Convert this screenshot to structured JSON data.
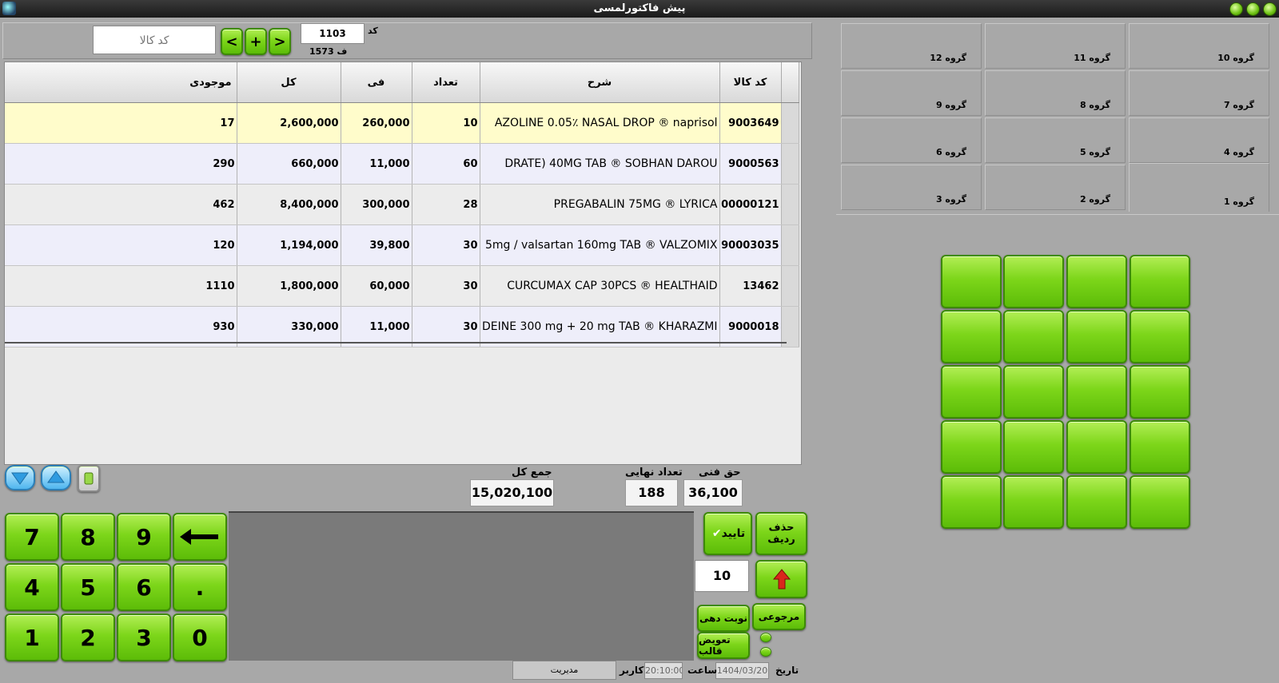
{
  "window": {
    "title": "پیش فاکتورلمسی"
  },
  "search": {
    "placeholder": "کد کالا",
    "nav_prev": "<",
    "nav_add": "+",
    "nav_next": ">",
    "code_label": "کد",
    "code_value": "1103",
    "invoice_label": "ف 1573"
  },
  "table": {
    "columns": [
      "موجودی",
      "کل",
      "فی",
      "تعداد",
      "شرح",
      "کد کالا"
    ],
    "rows": [
      {
        "stock": "17",
        "total": "2,600,000",
        "price": "260,000",
        "qty": "10",
        "desc": "AZOLINE 0.05٪ NASAL DROP ® naprisol",
        "code": "9003649"
      },
      {
        "stock": "290",
        "total": "660,000",
        "price": "11,000",
        "qty": "60",
        "desc": "DRATE) 40MG TAB ® SOBHAN DAROU",
        "code": "9000563"
      },
      {
        "stock": "462",
        "total": "8,400,000",
        "price": "300,000",
        "qty": "28",
        "desc": "PREGABALIN 75MG ® LYRICA",
        "code": "00000121"
      },
      {
        "stock": "120",
        "total": "1,194,000",
        "price": "39,800",
        "qty": "30",
        "desc": "5mg / valsartan 160mg TAB ® VALZOMIX",
        "code": "90003035"
      },
      {
        "stock": "1110",
        "total": "1,800,000",
        "price": "60,000",
        "qty": "30",
        "desc": "CURCUMAX CAP 30PCS ® HEALTHAID",
        "code": "13462"
      },
      {
        "stock": "930",
        "total": "330,000",
        "price": "11,000",
        "qty": "30",
        "desc": "DEINE 300 mg + 20 mg TAB ® KHARAZMI",
        "code": "9000018"
      }
    ]
  },
  "totals": {
    "grand_label": "جمع کل",
    "grand_value": "15,020,100",
    "count_label": "تعداد نهایی",
    "count_value": "188",
    "fee_label": "حق فنی",
    "fee_value": "36,100"
  },
  "keypad": {
    "k7": "7",
    "k8": "8",
    "k9": "9",
    "k4": "4",
    "k5": "5",
    "k6": "6",
    "kdot": ".",
    "k1": "1",
    "k2": "2",
    "k3": "3",
    "k0": "0"
  },
  "actions": {
    "delete_row": "حذف\nردیف",
    "confirm": "تایید",
    "qty_value": "10",
    "return": "مرجوعی",
    "queue": "نوبت دهی",
    "change_template": "تعویض قالب"
  },
  "groups": [
    "گروه 10",
    "گروه 11",
    "گروه 12",
    "گروه 7",
    "گروه 8",
    "گروه 9",
    "گروه 4",
    "گروه 5",
    "گروه 6",
    "گروه 1",
    "گروه 2",
    "گروه 3"
  ],
  "status": {
    "date_label": "تاریخ",
    "date_value": "1404/03/20",
    "time_label": "ساعت",
    "time_value": "20:10:00",
    "user_label": "کاربر",
    "user_value": "مدیریت"
  },
  "colors": {
    "accent": "#7dd61a",
    "highlight_row": "#fffccb",
    "alt_row": "#eeeefa"
  }
}
